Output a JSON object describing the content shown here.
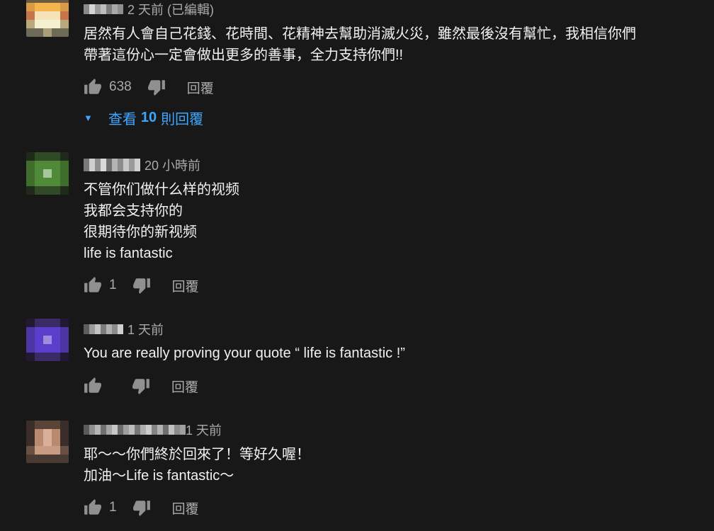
{
  "comments": [
    {
      "time": "2 天前 (已編輯)",
      "lines": [
        "居然有人會自己花錢、花時間、花精神去幫助消滅火災，雖然最後沒有幫忙，我相信你們",
        "帶著這份心一定會做出更多的善事，全力支持你們!!"
      ],
      "likes": "638",
      "reply_label": "回覆",
      "view_replies": {
        "prefix": "查看",
        "count": "10",
        "suffix": "則回覆"
      }
    },
    {
      "time": "20 小時前",
      "lines": [
        "不管你们做什么样的视频",
        "我都会支持你的",
        "很期待你的新视频",
        "life is fantastic"
      ],
      "likes": "1",
      "reply_label": "回覆"
    },
    {
      "time": "1 天前",
      "lines": [
        "You are really proving your quote “ life is fantastic !”"
      ],
      "likes": "",
      "reply_label": "回覆"
    },
    {
      "time": "1 天前",
      "lines": [
        "耶～～你們終於回來了！等好久喔！",
        "加油～Life is fantastic～"
      ],
      "likes": "1",
      "reply_label": "回覆"
    }
  ],
  "icons": {
    "like": "thumbs-up-icon",
    "dislike": "thumbs-down-icon",
    "expand": "caret-down-icon"
  },
  "colors": {
    "background": "#181818",
    "text": "#f1f1f1",
    "secondary": "#aaaaaa",
    "link": "#3ea6ff"
  }
}
